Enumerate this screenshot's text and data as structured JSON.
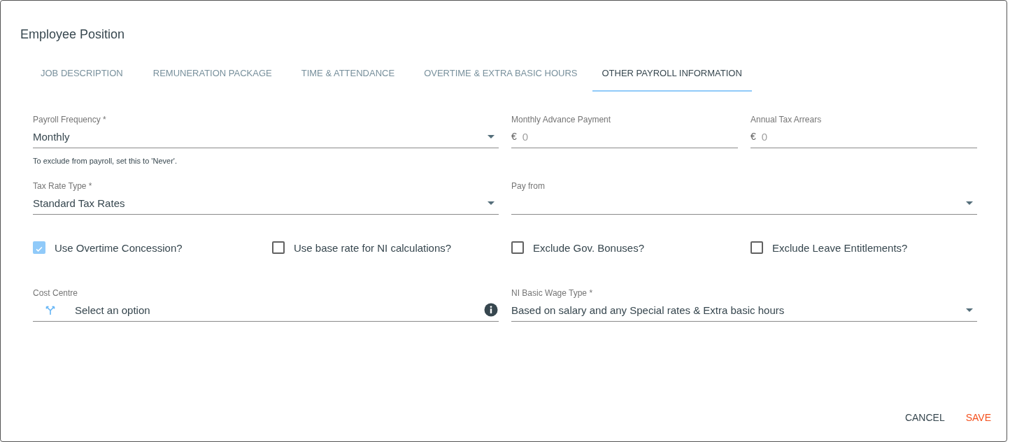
{
  "dialog": {
    "title": "Employee Position"
  },
  "tabs": [
    {
      "label": "JOB DESCRIPTION",
      "selected": false
    },
    {
      "label": "REMUNERATION PACKAGE",
      "selected": false
    },
    {
      "label": "TIME & ATTENDANCE",
      "selected": false
    },
    {
      "label": "OVERTIME & EXTRA BASIC HOURS",
      "selected": false
    },
    {
      "label": "OTHER PAYROLL INFORMATION",
      "selected": true
    }
  ],
  "rows": [
    {
      "fields": [
        {
          "kind": "select",
          "label": "Payroll Frequency *",
          "value": "Monthly",
          "hint": "To exclude from payroll, set this to 'Never'."
        },
        {
          "kind": "currency",
          "label": "Monthly Advance Payment",
          "currency": "€",
          "placeholder": "0"
        },
        {
          "kind": "currency",
          "label": "Annual Tax Arrears",
          "currency": "€",
          "placeholder": "0"
        }
      ]
    },
    {
      "fields": [
        {
          "kind": "select",
          "label": "Tax Rate Type *",
          "value": "Standard Tax Rates"
        },
        {
          "kind": "select",
          "label": "Pay from"
        }
      ]
    },
    {
      "fields": [
        {
          "kind": "checkbox",
          "label": "Use Overtime Concession?",
          "checked": true
        },
        {
          "kind": "checkbox",
          "label": "Use base rate for NI calculations?",
          "checked": false
        },
        {
          "kind": "checkbox",
          "label": "Exclude Gov. Bonuses?",
          "checked": false
        },
        {
          "kind": "checkbox",
          "label": "Exclude Leave Entitlements?",
          "checked": false
        }
      ]
    },
    {
      "fields": [
        {
          "kind": "lookup",
          "label": "Cost Centre",
          "placeholder": "Select an option"
        },
        {
          "kind": "select",
          "label": "NI Basic Wage Type *",
          "value": "Based on salary and any Special rates & Extra basic hours"
        }
      ]
    }
  ],
  "buttons": [
    {
      "label": "CANCEL",
      "kind": "secondary"
    },
    {
      "label": "SAVE",
      "kind": "primary"
    }
  ]
}
